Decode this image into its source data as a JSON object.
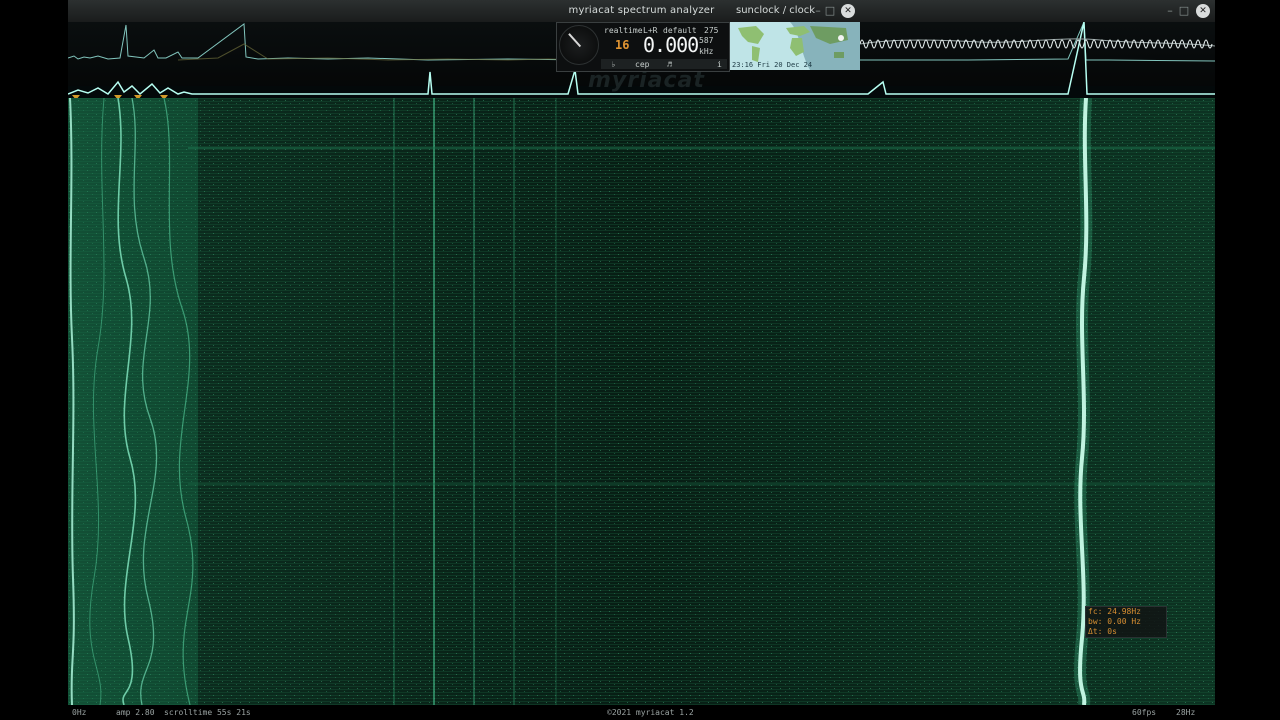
{
  "window": {
    "title": "myriacat spectrum analyzer",
    "controls": {
      "minimize": "–",
      "maximize": "□",
      "close": "✕"
    }
  },
  "widget": {
    "mode": "realtime",
    "channel": "L+R",
    "preset": "default",
    "level": "275",
    "sub_value": "587",
    "unit": "kHz",
    "frequency": "0.000",
    "orange_value": "16",
    "buttons": [
      "♭",
      "cep",
      "♬"
    ],
    "info_icon": "i"
  },
  "watermark": "myriacat",
  "sunclock": {
    "title": "sunclock / clock",
    "controls": {
      "minimize": "–",
      "maximize": "□",
      "close": "✕"
    },
    "time": "23:16 Fri 20 Dec 24"
  },
  "cursor_readout": {
    "fc": "fc: 24.98Hz",
    "bw": "bw: 0.00 Hz",
    "dt": "Δt: 0s"
  },
  "status": {
    "left_freq": "0Hz",
    "amp": "amp 2.80",
    "scrolltime": "scrolltime 55s 21s",
    "copyright": "©2021 myriacat 1.2",
    "fps": "60fps",
    "right_freq": "28Hz"
  },
  "colors": {
    "waterfall_bg": "#0a2a1c",
    "signal": "#7fffd0",
    "accent_orange": "#e29532",
    "marker": "#d49b2a"
  }
}
